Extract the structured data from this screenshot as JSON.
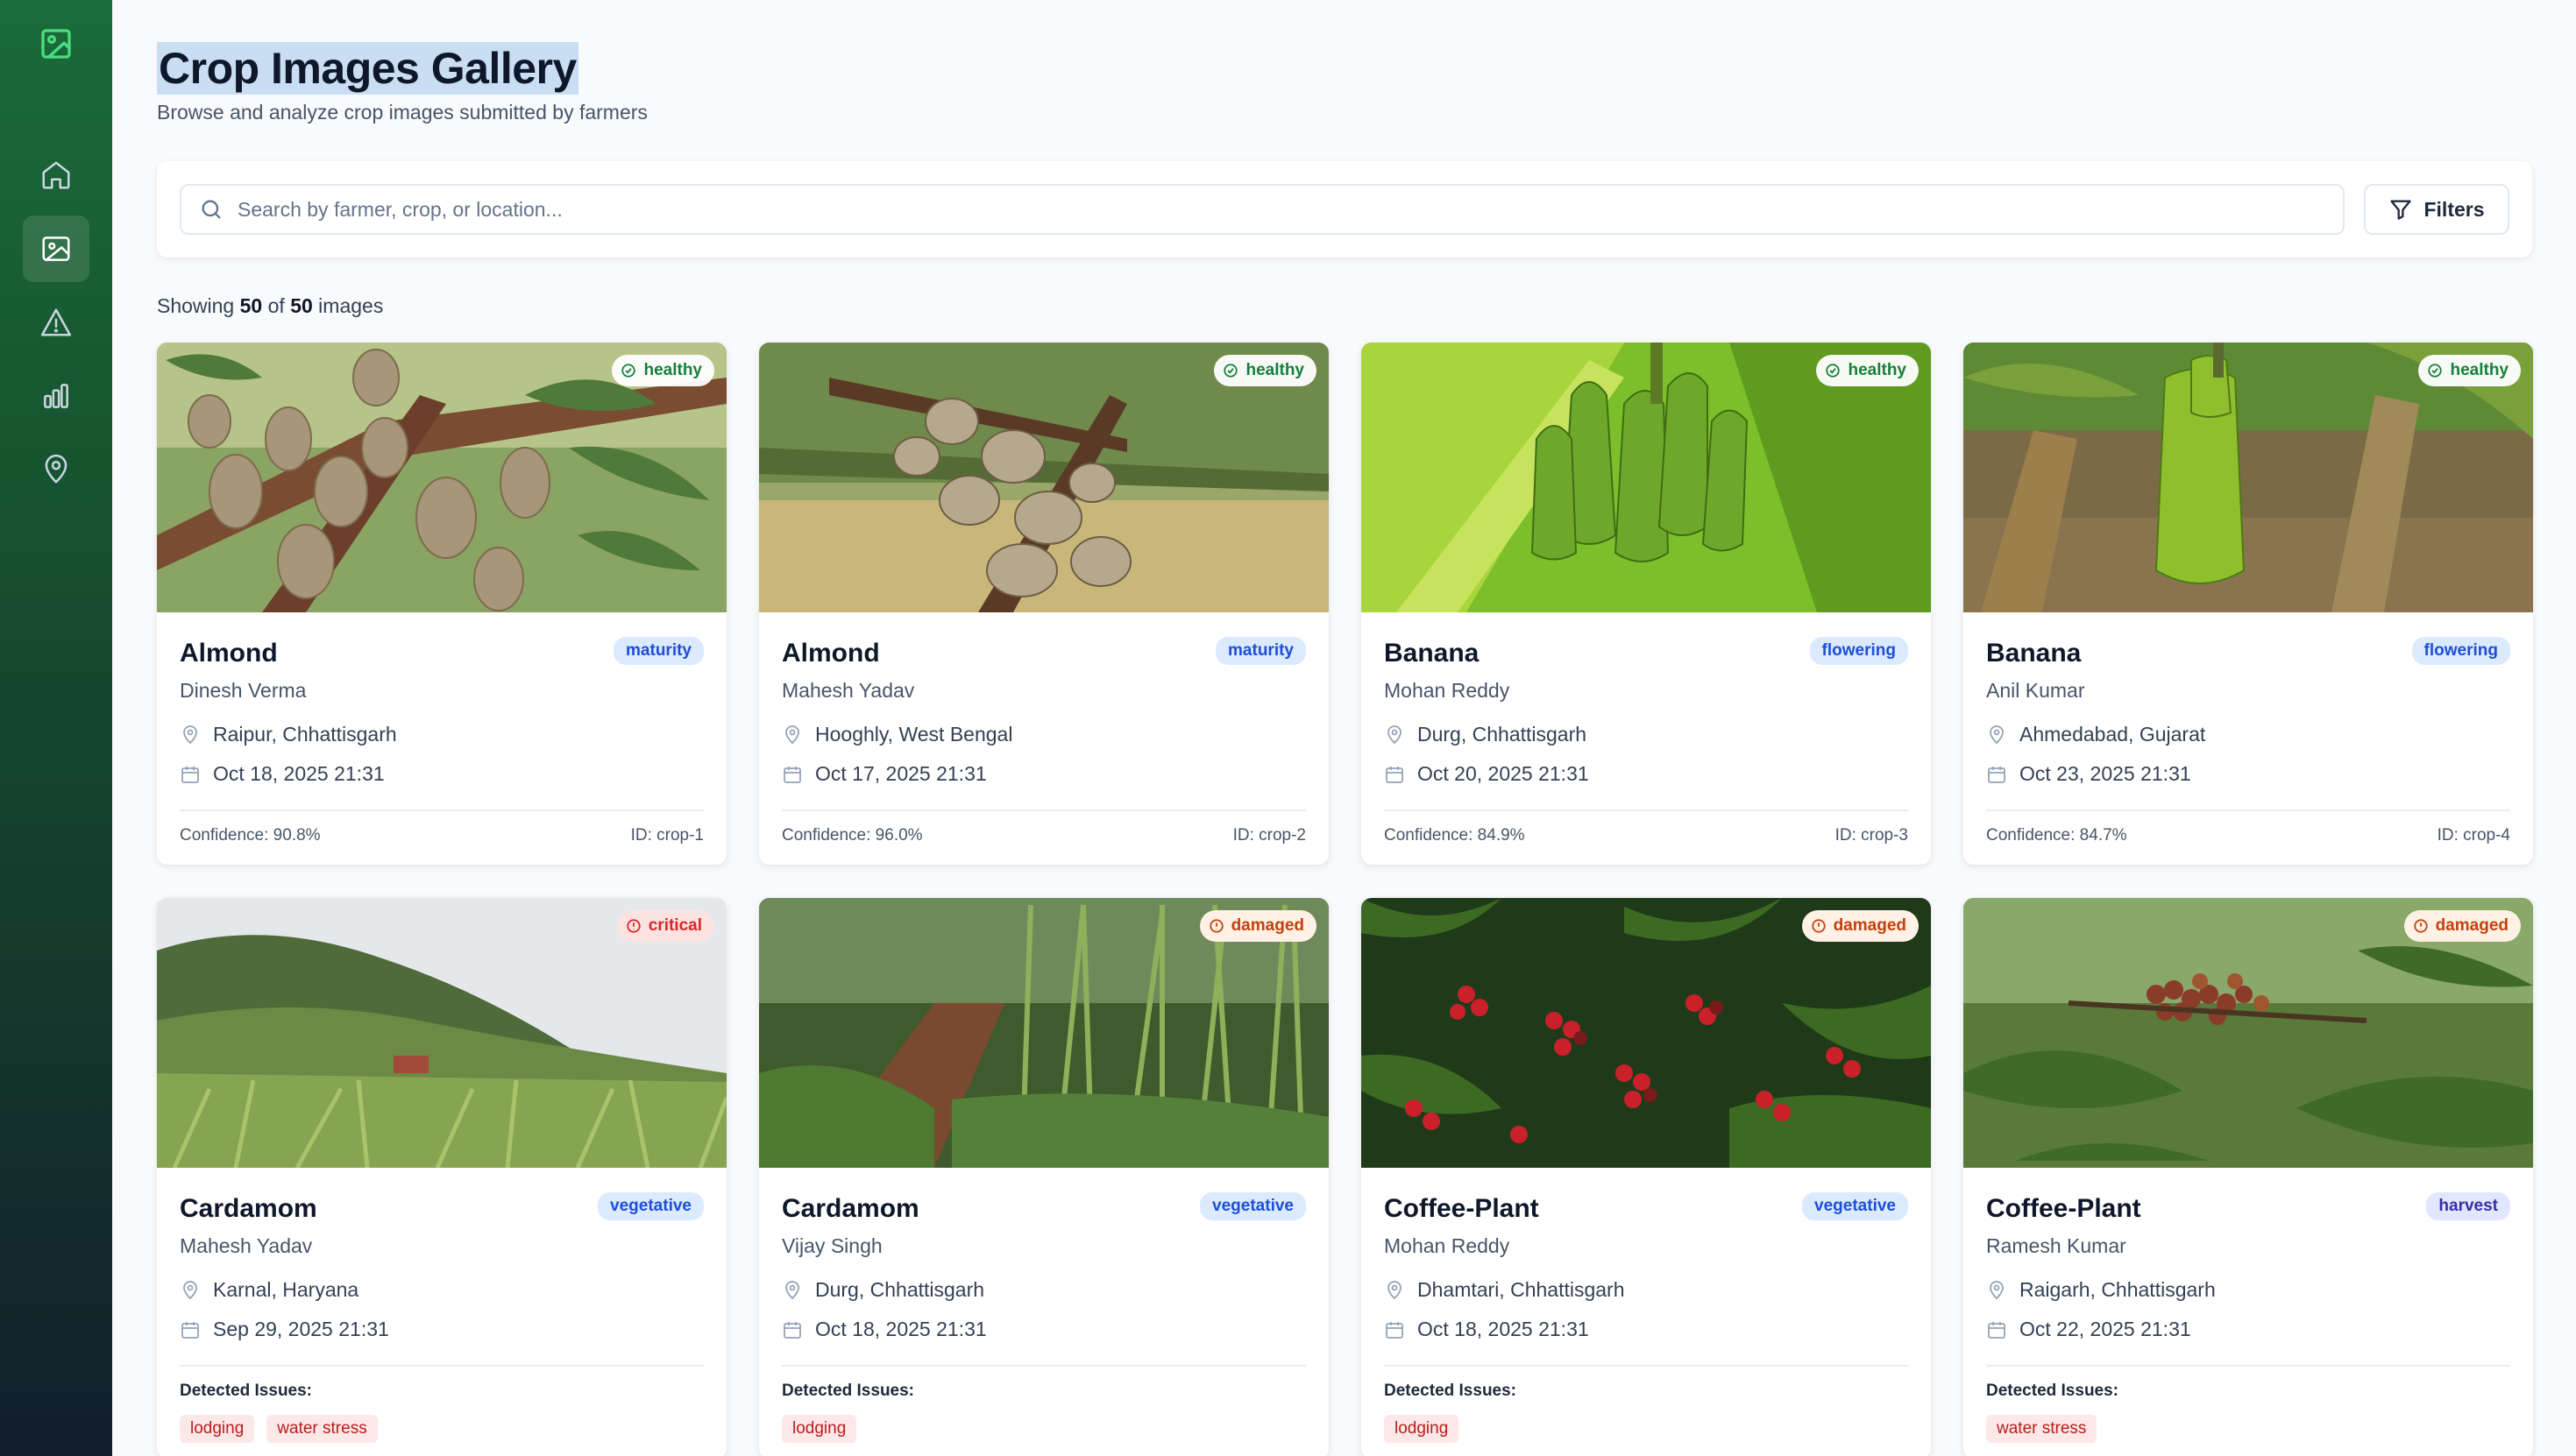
{
  "page": {
    "title": "Crop Images Gallery",
    "subtitle": "Browse and analyze crop images submitted by farmers"
  },
  "sidebar": {
    "logo_icon": "image-icon",
    "items": [
      {
        "icon": "home-icon",
        "active": false
      },
      {
        "icon": "image-icon",
        "active": true
      },
      {
        "icon": "alert-triangle-icon",
        "active": false
      },
      {
        "icon": "bar-chart-icon",
        "active": false
      },
      {
        "icon": "map-pin-icon",
        "active": false
      }
    ]
  },
  "search": {
    "placeholder": "Search by farmer, crop, or location...",
    "value": ""
  },
  "filters": {
    "label": "Filters"
  },
  "results": {
    "prefix": "Showing",
    "shown": "50",
    "of": "of",
    "total": "50",
    "suffix": "images"
  },
  "labels": {
    "detected_issues": "Detected Issues:"
  },
  "colors": {
    "sidebar_top": "#1a6b3a",
    "sidebar_bottom": "#121d2b",
    "healthy": "#15803d",
    "critical": "#dc2626",
    "damaged": "#c2410c",
    "stage_badge_bg": "#dbeafe",
    "issue_tag_bg": "#fde8e8"
  },
  "cards": [
    {
      "crop": "Almond",
      "farmer": "Dinesh Verma",
      "location": "Raipur, Chhattisgarh",
      "date": "Oct 18, 2025 21:31",
      "status": "healthy",
      "stage": "maturity",
      "confidence": "Confidence: 90.8%",
      "id": "ID: crop-1"
    },
    {
      "crop": "Almond",
      "farmer": "Mahesh Yadav",
      "location": "Hooghly, West Bengal",
      "date": "Oct 17, 2025 21:31",
      "status": "healthy",
      "stage": "maturity",
      "confidence": "Confidence: 96.0%",
      "id": "ID: crop-2"
    },
    {
      "crop": "Banana",
      "farmer": "Mohan Reddy",
      "location": "Durg, Chhattisgarh",
      "date": "Oct 20, 2025 21:31",
      "status": "healthy",
      "stage": "flowering",
      "confidence": "Confidence: 84.9%",
      "id": "ID: crop-3"
    },
    {
      "crop": "Banana",
      "farmer": "Anil Kumar",
      "location": "Ahmedabad, Gujarat",
      "date": "Oct 23, 2025 21:31",
      "status": "healthy",
      "stage": "flowering",
      "confidence": "Confidence: 84.7%",
      "id": "ID: crop-4"
    },
    {
      "crop": "Cardamom",
      "farmer": "Mahesh Yadav",
      "location": "Karnal, Haryana",
      "date": "Sep 29, 2025 21:31",
      "status": "critical",
      "stage": "vegetative",
      "issues": [
        "lodging",
        "water stress"
      ]
    },
    {
      "crop": "Cardamom",
      "farmer": "Vijay Singh",
      "location": "Durg, Chhattisgarh",
      "date": "Oct 18, 2025 21:31",
      "status": "damaged",
      "stage": "vegetative",
      "issues": [
        "lodging"
      ]
    },
    {
      "crop": "Coffee-Plant",
      "farmer": "Mohan Reddy",
      "location": "Dhamtari, Chhattisgarh",
      "date": "Oct 18, 2025 21:31",
      "status": "damaged",
      "stage": "vegetative",
      "issues": [
        "lodging"
      ]
    },
    {
      "crop": "Coffee-Plant",
      "farmer": "Ramesh Kumar",
      "location": "Raigarh, Chhattisgarh",
      "date": "Oct 22, 2025 21:31",
      "status": "damaged",
      "stage": "harvest",
      "issues": [
        "water stress"
      ]
    }
  ]
}
